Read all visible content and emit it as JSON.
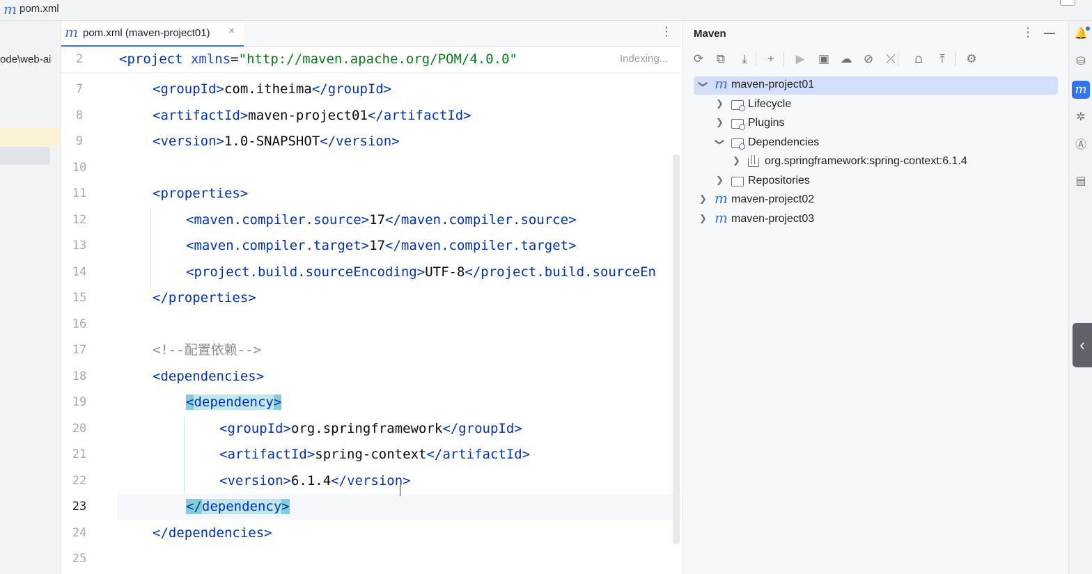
{
  "window": {
    "title": "pom.xml"
  },
  "project_panel": {
    "path_fragment": "ode\\web-ai"
  },
  "editor": {
    "tab_label": "pom.xml (maven-project01)",
    "status": "Indexing...",
    "sticky_line": {
      "num": "2",
      "tag_open": "<project",
      "attr": "xmlns",
      "eq": "=",
      "val": "\"http://maven.apache.org/POM/4.0.0\"",
      "close": ""
    },
    "lines": [
      {
        "num": "7",
        "parts": [
          "<",
          "groupId",
          ">",
          "com.itheima",
          "</",
          "groupId",
          ">"
        ]
      },
      {
        "num": "8",
        "parts": [
          "<",
          "artifactId",
          ">",
          "maven-project01",
          "</",
          "artifactId",
          ">"
        ]
      },
      {
        "num": "9",
        "parts": [
          "<",
          "version",
          ">",
          "1.0-SNAPSHOT",
          "</",
          "version",
          ">"
        ]
      },
      {
        "num": "10",
        "parts": []
      },
      {
        "num": "11",
        "parts": [
          "<",
          "properties",
          ">"
        ]
      },
      {
        "num": "12",
        "parts": [
          "<",
          "maven.compiler.source",
          ">",
          "17",
          "</",
          "maven.compiler.source",
          ">"
        ]
      },
      {
        "num": "13",
        "parts": [
          "<",
          "maven.compiler.target",
          ">",
          "17",
          "</",
          "maven.compiler.target",
          ">"
        ]
      },
      {
        "num": "14",
        "parts": [
          "<",
          "project.build.sourceEncoding",
          ">",
          "UTF-8",
          "</",
          "project.build.sourceEn"
        ]
      },
      {
        "num": "15",
        "parts": [
          "</",
          "properties",
          ">"
        ]
      },
      {
        "num": "16",
        "parts": []
      },
      {
        "num": "17",
        "comment": "<!--配置依赖-->"
      },
      {
        "num": "18",
        "parts": [
          "<",
          "dependencies",
          ">"
        ]
      },
      {
        "num": "19",
        "parts": [
          "<",
          "dependency",
          ">"
        ]
      },
      {
        "num": "20",
        "parts": [
          "<",
          "groupId",
          ">",
          "org.springframework",
          "</",
          "groupId",
          ">"
        ]
      },
      {
        "num": "21",
        "parts": [
          "<",
          "artifactId",
          ">",
          "spring-context",
          "</",
          "artifactId",
          ">"
        ]
      },
      {
        "num": "22",
        "parts": [
          "<",
          "version",
          ">",
          "6.1.4",
          "</",
          "version",
          ">"
        ]
      },
      {
        "num": "23",
        "parts": [
          "</",
          "dependency",
          ">"
        ]
      },
      {
        "num": "24",
        "parts": [
          "</",
          "dependencies",
          ">"
        ]
      },
      {
        "num": "25",
        "parts": []
      }
    ]
  },
  "maven": {
    "title": "Maven",
    "toolbar_icons": [
      "reload-icon",
      "generate-sources-icon",
      "download-icon",
      "add-icon",
      "run-icon",
      "execute-goal-icon",
      "offline-icon",
      "skip-tests-icon",
      "collapse-icon",
      "show-dependencies-icon",
      "expand-icon",
      "settings-icon"
    ],
    "tree": [
      {
        "label": "maven-project01",
        "level": 0,
        "kind": "project",
        "expanded": true,
        "selected": true
      },
      {
        "label": "Lifecycle",
        "level": 1,
        "kind": "folder-gear",
        "expanded": false
      },
      {
        "label": "Plugins",
        "level": 1,
        "kind": "folder-gear",
        "expanded": false
      },
      {
        "label": "Dependencies",
        "level": 1,
        "kind": "folder-gear",
        "expanded": true
      },
      {
        "label": "org.springframework:spring-context:6.1.4",
        "level": 2,
        "kind": "library",
        "expanded": false
      },
      {
        "label": "Repositories",
        "level": 1,
        "kind": "folder",
        "expanded": false
      },
      {
        "label": "maven-project02",
        "level": 0,
        "kind": "project",
        "expanded": false
      },
      {
        "label": "maven-project03",
        "level": 0,
        "kind": "project",
        "expanded": false
      }
    ]
  },
  "right_toolbar": [
    "notifications-icon",
    "database-icon",
    "maven-icon",
    "plugin-icon",
    "ai-assistant-icon",
    "translate-icon"
  ],
  "colors": {
    "accent": "#3574f0",
    "tag": "#0033b3",
    "string": "#067d17",
    "match_bg": "#bfe7ec"
  }
}
